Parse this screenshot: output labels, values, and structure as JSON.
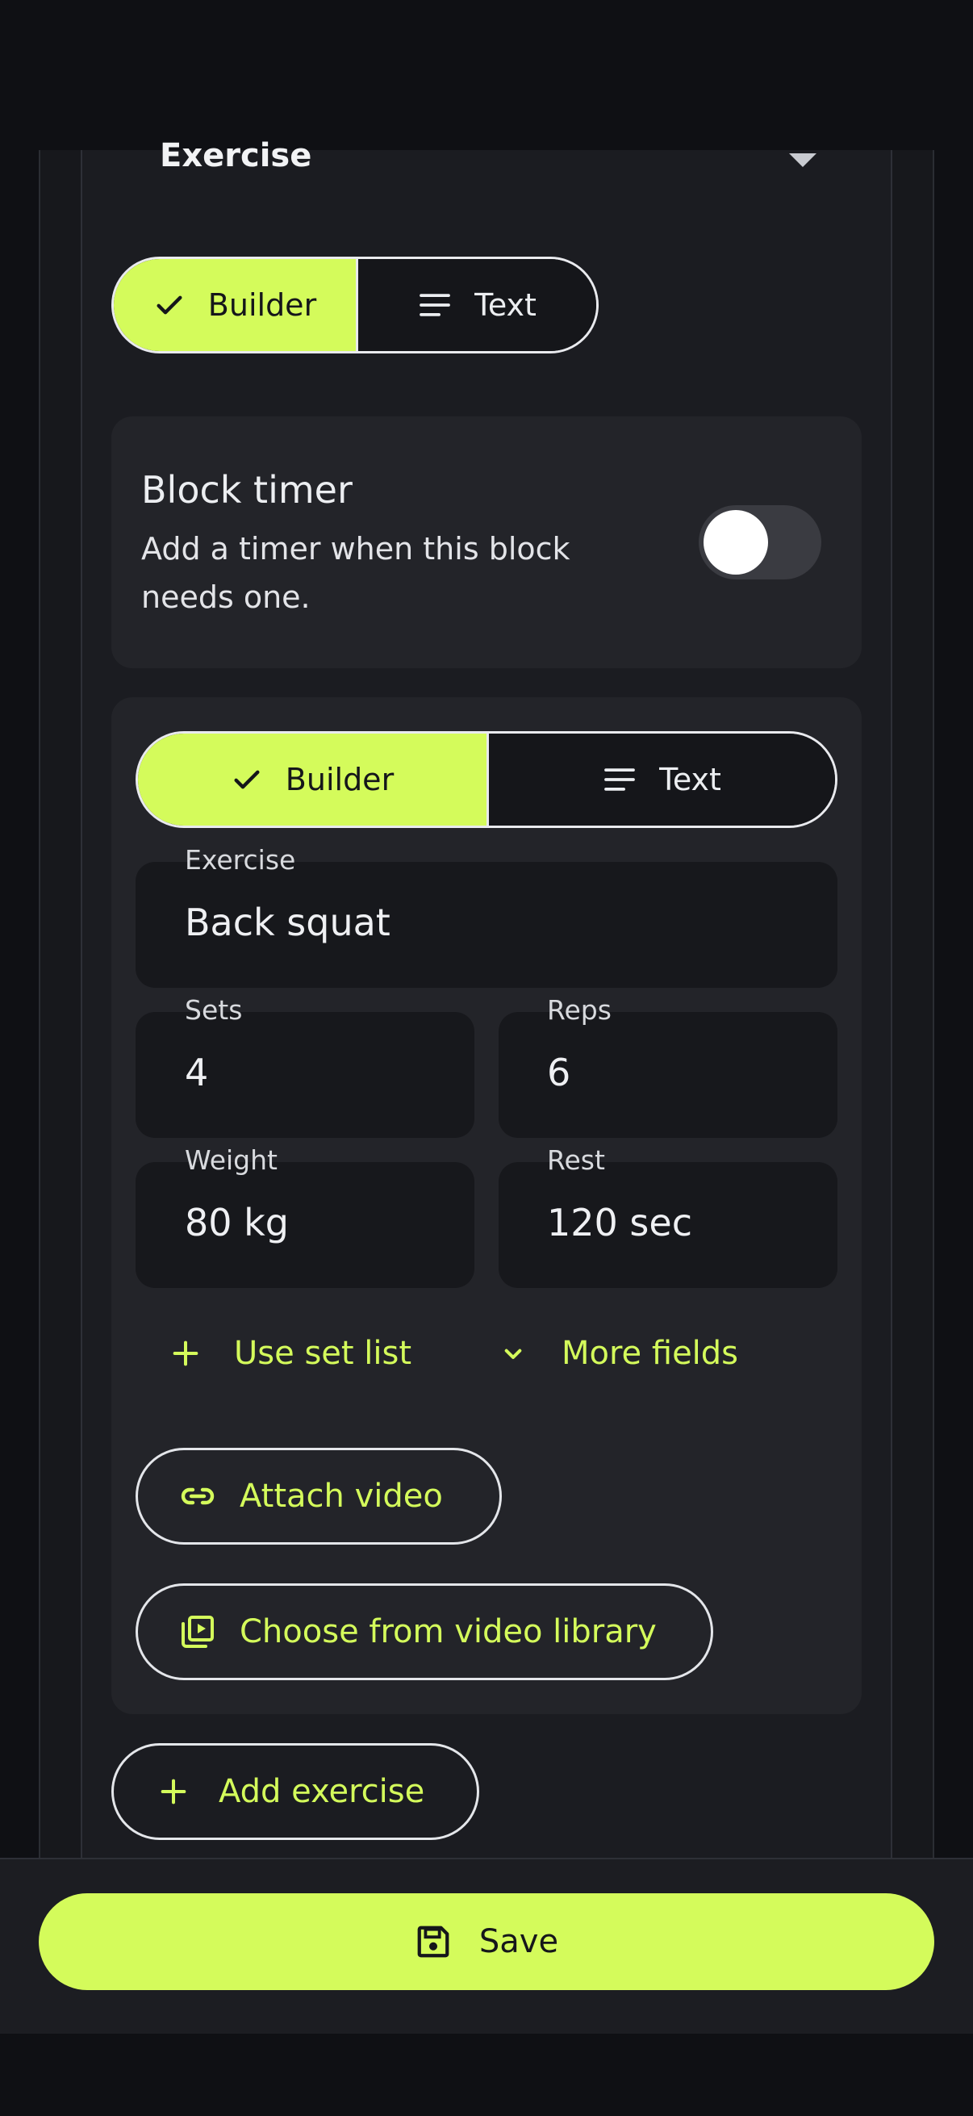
{
  "colors": {
    "accent": "#d4fb5b",
    "background": "#0f1014",
    "card": "#232429",
    "field": "#17181c"
  },
  "header": {
    "section_label": "Exercise",
    "caret_icon": "caret-down-icon"
  },
  "mode_toggle": {
    "builder_label": "Builder",
    "text_label": "Text",
    "selected": "Builder"
  },
  "block_timer": {
    "title": "Block timer",
    "description": "Add a timer when this block needs one.",
    "enabled": false
  },
  "exercise_card": {
    "mode_toggle": {
      "builder_label": "Builder",
      "text_label": "Text",
      "selected": "Builder"
    },
    "fields": {
      "exercise": {
        "label": "Exercise",
        "value": "Back squat"
      },
      "sets": {
        "label": "Sets",
        "value": "4"
      },
      "reps": {
        "label": "Reps",
        "value": "6"
      },
      "weight": {
        "label": "Weight",
        "value": "80 kg"
      },
      "rest": {
        "label": "Rest",
        "value": "120 sec"
      }
    },
    "use_set_list_label": "Use set list",
    "more_fields_label": "More fields",
    "attach_video_label": "Attach video",
    "video_library_label": "Choose from video library"
  },
  "add_exercise_label": "Add exercise",
  "save_label": "Save"
}
